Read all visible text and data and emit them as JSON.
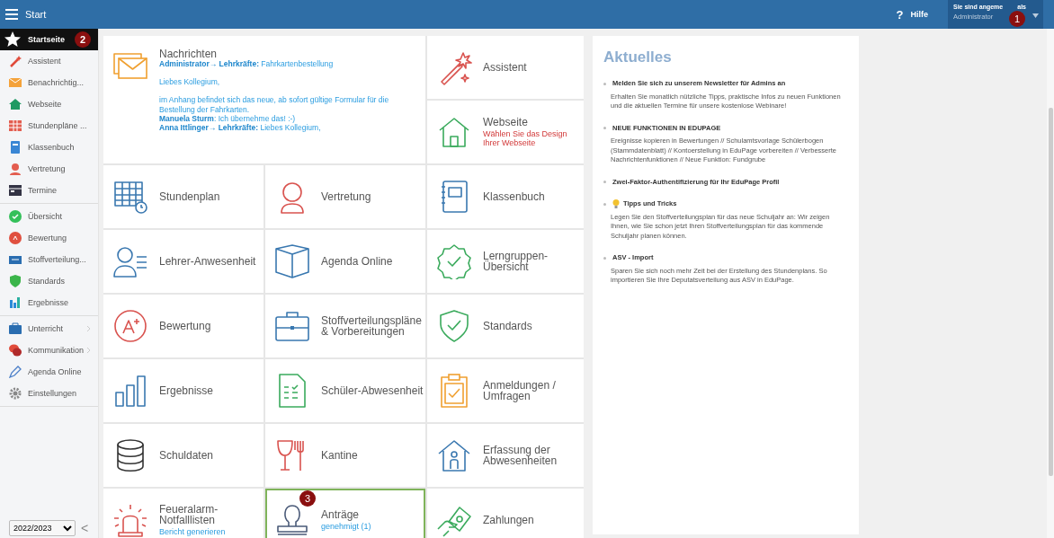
{
  "top_bar": {
    "title": "Start",
    "help_icon": "?",
    "help": "Hilfe",
    "user": {
      "label_start": "Sie sind angeme",
      "label_end": "als",
      "name": "Administrator",
      "badge": "1"
    }
  },
  "sidebar": {
    "groups": [
      [
        {
          "label": "Startseite",
          "selected": true,
          "badge": "2",
          "expandable": false
        },
        {
          "label": "Assistent",
          "selected": false,
          "expandable": false
        },
        {
          "label": "Benachrichtig...",
          "selected": false,
          "expandable": false
        },
        {
          "label": "Webseite",
          "selected": false,
          "expandable": false
        },
        {
          "label": "Stundenpläne ...",
          "selected": false,
          "expandable": false
        },
        {
          "label": "Klassenbuch",
          "selected": false,
          "expandable": false
        },
        {
          "label": "Vertretung",
          "selected": false,
          "expandable": false
        },
        {
          "label": "Termine",
          "selected": false,
          "expandable": false
        }
      ],
      [
        {
          "label": "Übersicht",
          "selected": false,
          "expandable": false
        },
        {
          "label": "Bewertung",
          "selected": false,
          "expandable": false
        },
        {
          "label": "Stoffverteilung...",
          "selected": false,
          "expandable": false
        },
        {
          "label": "Standards",
          "selected": false,
          "expandable": false
        },
        {
          "label": "Ergebnisse",
          "selected": false,
          "expandable": false
        }
      ],
      [
        {
          "label": "Unterricht",
          "selected": false,
          "expandable": true
        },
        {
          "label": "Kommunikation",
          "selected": false,
          "expandable": true
        },
        {
          "label": "Agenda Online",
          "selected": false,
          "expandable": false
        },
        {
          "label": "Einstellungen",
          "selected": false,
          "expandable": false
        }
      ]
    ],
    "year_select": {
      "value": "2022/2023"
    },
    "collapse": "<"
  },
  "tiles": [
    {
      "title": "Nachrichten",
      "kind": "messages",
      "highlighted": false,
      "message_blocks": [
        [
          "**Administrator→ Lehrkräfte:** Fahrkartenbestellung"
        ],
        [
          "Liebes Kollegium,"
        ],
        [
          "im Anhang befindet sich das neue, ab sofort gültige Formular für die Bestellung der Fahrkarten.",
          "**Manuela Sturm**: Ich übernehme das! :-)",
          "**Anna Ittlinger→ Lehrkräfte:** Liebes Kollegium,"
        ]
      ]
    },
    {
      "title": "Assistent",
      "kind": "plain",
      "highlighted": false
    },
    {
      "title": "Webseite",
      "kind": "plain",
      "highlighted": false,
      "subtitle": {
        "kind": "alert",
        "text": "Wählen Sie das Design Ihrer Webseite"
      }
    },
    {
      "title": "Stundenplan",
      "kind": "plain",
      "highlighted": false
    },
    {
      "title": "Vertretung",
      "kind": "plain",
      "highlighted": false
    },
    {
      "title": "Klassenbuch",
      "kind": "plain",
      "highlighted": false
    },
    {
      "title": "Lehrer-Anwesenheit",
      "kind": "plain",
      "highlighted": false
    },
    {
      "title": "Agenda Online",
      "kind": "plain",
      "highlighted": false
    },
    {
      "title": "Lerngruppen-Übersicht",
      "kind": "plain",
      "highlighted": false
    },
    {
      "title": "Bewertung",
      "kind": "plain",
      "highlighted": false
    },
    {
      "title": "Stoffverteilungspläne & Vorbereitungen",
      "kind": "plain",
      "highlighted": false
    },
    {
      "title": "Standards",
      "kind": "plain",
      "highlighted": false
    },
    {
      "title": "Ergebnisse",
      "kind": "plain",
      "highlighted": false
    },
    {
      "title": "Schüler-Abwesenheit",
      "kind": "plain",
      "highlighted": false
    },
    {
      "title": "Anmeldungen / Umfragen",
      "kind": "plain",
      "highlighted": false
    },
    {
      "title": "Schuldaten",
      "kind": "plain",
      "highlighted": false
    },
    {
      "title": "Kantine",
      "kind": "plain",
      "highlighted": false
    },
    {
      "title": "Erfassung der Abwesenheiten",
      "kind": "plain",
      "highlighted": false
    },
    {
      "title": "Feueralarm-Notfalllisten",
      "kind": "plain",
      "highlighted": false,
      "subtitle": {
        "kind": "link",
        "text": "Bericht generieren"
      }
    },
    {
      "title": "Anträge",
      "kind": "plain",
      "highlighted": true,
      "badge": "3",
      "subtitle": {
        "kind": "link",
        "text": "genehmigt (1)"
      }
    },
    {
      "title": "Zahlungen",
      "kind": "plain",
      "highlighted": false
    }
  ],
  "news": {
    "heading": "Aktuelles",
    "items": [
      {
        "kind": "news",
        "title": "Melden Sie sich zu unserem Newsletter für Admins an",
        "text": "Erhalten Sie monatlich nützliche Tipps, praktische Infos zu neuen Funktionen und die aktuellen Termine für unsere kostenlose Webinare!"
      },
      {
        "kind": "news",
        "title": "NEUE FUNKTIONEN IN EDUPAGE",
        "text": "Ereignisse kopieren in Bewertungen // Schulamtsvorlage Schülerbogen (Stammdatenblatt) // Kontoerstellung in EduPage vorbereiten // Verbesserte Nachrichtenfunktionen // Neue Funktion: Fundgrube"
      },
      {
        "kind": "news",
        "title": "Zwei-Faktor-Authentifizierung für Ihr EduPage Profil"
      },
      {
        "kind": "tip",
        "title": "Tipps und Tricks",
        "text": "Legen Sie den Stoffverteilungsplan für das neue Schuljahr an: Wir zeigen Ihnen, wie Sie schon jetzt Ihren Stoffverteilungsplan für das kommende Schuljahr planen können."
      },
      {
        "kind": "news",
        "title": "ASV - Import",
        "text": "Sparen Sie sich noch mehr Zeit bei der Erstellung des Stundenplans. So importieren Sie Ihre Deputatsverteilung aus ASV in EduPage."
      }
    ]
  }
}
